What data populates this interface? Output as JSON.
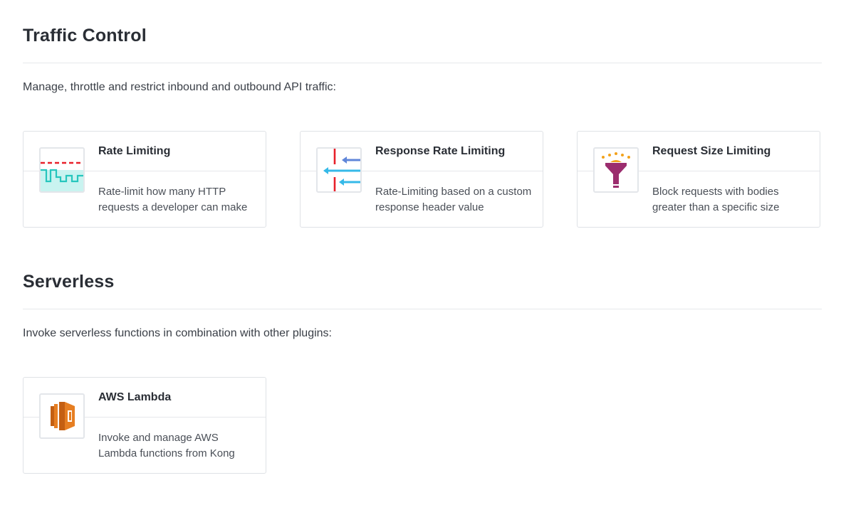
{
  "traffic_control": {
    "title": "Traffic Control",
    "description": "Manage, throttle and restrict inbound and outbound API traffic:",
    "cards": [
      {
        "title": "Rate Limiting",
        "description": "Rate-limit how many HTTP requests a developer can make",
        "icon": "rate-limiting-icon"
      },
      {
        "title": "Response Rate Limiting",
        "description": "Rate-Limiting based on a custom response header value",
        "icon": "response-rate-limiting-icon"
      },
      {
        "title": "Request Size Limiting",
        "description": "Block requests with bodies greater than a specific size",
        "icon": "funnel-icon"
      }
    ]
  },
  "serverless": {
    "title": "Serverless",
    "description": "Invoke serverless functions in combination with other plugins:",
    "cards": [
      {
        "title": "AWS Lambda",
        "description": "Invoke and manage AWS Lambda functions from Kong",
        "icon": "aws-lambda-icon"
      }
    ]
  },
  "colors": {
    "rate_limit_red": "#e8202a",
    "rate_limit_teal": "#27c6bd",
    "arrow_blue": "#5f86d9",
    "arrow_cyan": "#35b9e8",
    "funnel_purple": "#9b2d6e",
    "funnel_dots": "#f2a21b",
    "lambda_orange": "#e67e22"
  }
}
